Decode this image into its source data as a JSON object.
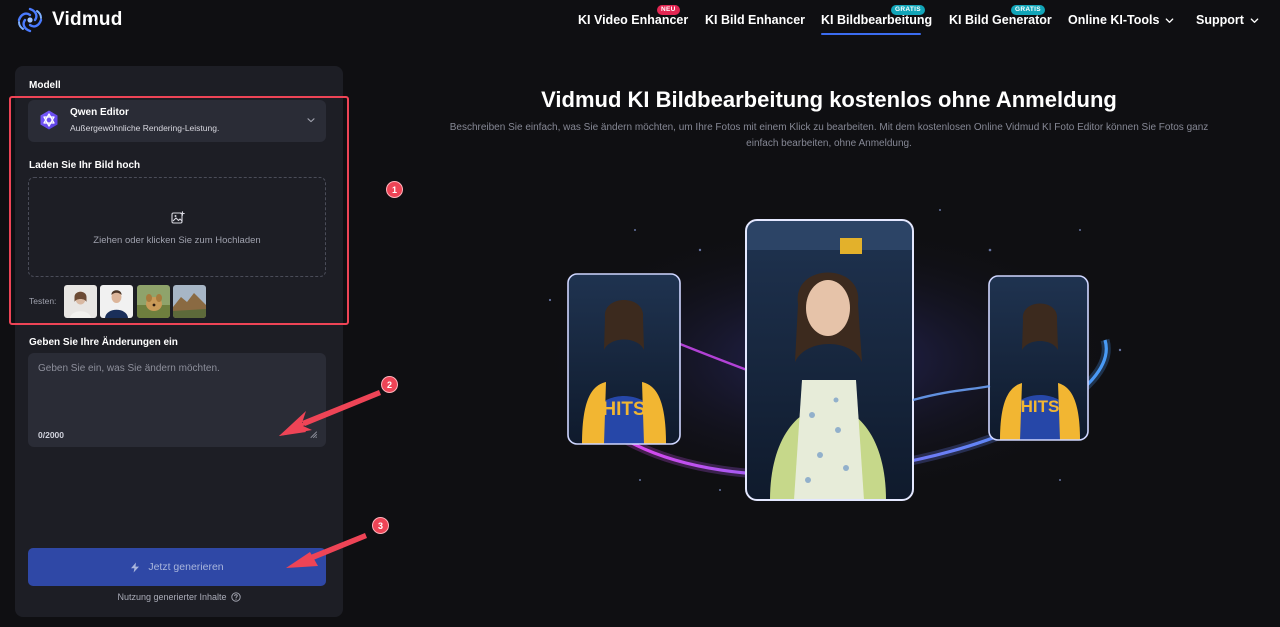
{
  "brand": {
    "name": "Vidmud"
  },
  "nav": {
    "items": [
      {
        "label": "KI Video Enhancer",
        "badge": "NEU"
      },
      {
        "label": "KI Bild Enhancer",
        "badge": ""
      },
      {
        "label": "KI Bildbearbeitung",
        "badge": "GRATIS",
        "active": true
      },
      {
        "label": "KI Bild Generator",
        "badge": "GRATIS"
      },
      {
        "label": "Online KI-Tools",
        "badge": "",
        "dropdown": true
      },
      {
        "label": "Support",
        "badge": "",
        "dropdown": true
      }
    ]
  },
  "panel": {
    "model_label": "Modell",
    "model": {
      "name": "Qwen Editor",
      "description": "Außergewöhnliche Rendering-Leistung."
    },
    "upload_label": "Laden Sie Ihr Bild hoch",
    "upload_text": "Ziehen oder klicken Sie zum Hochladen",
    "test_label": "Testen:",
    "changes_label": "Geben Sie Ihre Änderungen ein",
    "changes_placeholder": "Geben Sie ein, was Sie ändern möchten.",
    "counter": "0/2000",
    "generate_label": "Jetzt generieren",
    "usage_label": "Nutzung generierter Inhalte"
  },
  "markers": [
    "1",
    "2",
    "3"
  ],
  "hero": {
    "title": "Vidmud KI Bildbearbeitung kostenlos ohne Anmeldung",
    "description": "Beschreiben Sie einfach, was Sie ändern möchten, um Ihre Fotos mit einem Klick zu bearbeiten. Mit dem kostenlosen Online Vidmud KI Foto Editor können Sie Fotos ganz einfach bearbeiten, ohne Anmeldung."
  },
  "colors": {
    "accent": "#3b6cf0",
    "annotation": "#ee4456",
    "badge_new": "#e32753",
    "badge_free": "#12a5b8"
  }
}
